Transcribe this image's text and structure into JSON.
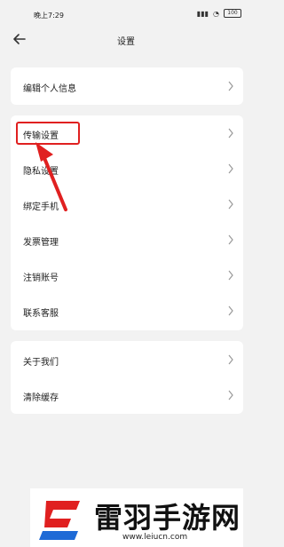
{
  "status_bar": {
    "time": "晚上7:29",
    "signal_icon": "signal-icon",
    "wifi_icon": "wifi-icon",
    "battery": "100"
  },
  "header": {
    "title": "设置",
    "back_icon": "back-arrow-icon"
  },
  "sections": [
    {
      "items": [
        {
          "label": "编辑个人信息"
        }
      ]
    },
    {
      "items": [
        {
          "label": "传输设置"
        },
        {
          "label": "隐私设置"
        },
        {
          "label": "绑定手机"
        },
        {
          "label": "发票管理"
        },
        {
          "label": "注销账号"
        },
        {
          "label": "联系客服"
        }
      ]
    },
    {
      "items": [
        {
          "label": "关于我们"
        },
        {
          "label": "清除缓存"
        }
      ]
    }
  ],
  "annotation": {
    "highlight_color": "#e02020"
  },
  "watermark": {
    "title": "雷羽手游网",
    "url": "www.leiucn.com",
    "logo_colors": [
      "#e02020",
      "#1e6ad6"
    ]
  }
}
